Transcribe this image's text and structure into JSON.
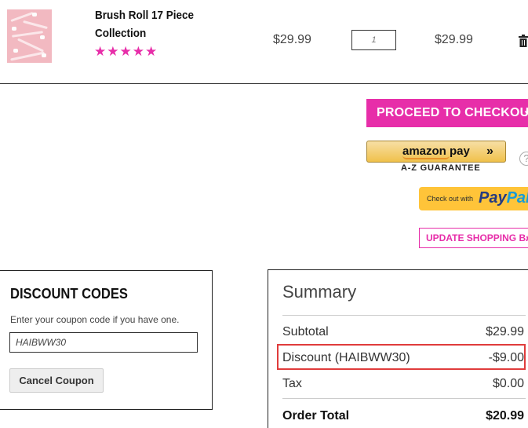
{
  "product": {
    "name": "Brush Roll 17 Piece Collection",
    "rating_stars": "★★★★★",
    "rating_value": 5,
    "price": "$29.99",
    "quantity": "1",
    "line_total": "$29.99"
  },
  "actions": {
    "checkout_label": "PROCEED TO CHECKOUT",
    "checkout_chevron": "›",
    "amazon_label": "amazon pay",
    "amazon_arrows": "»",
    "amazon_guarantee": "A-Z GUARANTEE",
    "help_mark": "?",
    "paypal_small": "Check out with",
    "paypal_logo_a": "Pay",
    "paypal_logo_b": "Pal",
    "update_label": "UPDATE SHOPPING BAG",
    "update_chevron": "›"
  },
  "discount": {
    "title": "DISCOUNT CODES",
    "help_text": "Enter your coupon code if you have one.",
    "code_value": "HAIBWW30",
    "cancel_label": "Cancel Coupon"
  },
  "summary": {
    "title": "Summary",
    "rows": [
      {
        "label": "Subtotal",
        "value": "$29.99"
      },
      {
        "label": "Discount (HAIBWW30)",
        "value": "-$9.00"
      },
      {
        "label": "Tax",
        "value": "$0.00"
      }
    ],
    "order_total_label": "Order Total",
    "order_total_value": "$20.99"
  },
  "colors": {
    "brand_pink": "#e72ea9",
    "highlight_red": "#e03c3c",
    "amazon_gold": "#f0c14b",
    "paypal_yellow": "#ffc439"
  },
  "icons": {
    "trash": "trash-icon",
    "checkout_chevron": "chevron-right-icon",
    "help": "help-icon"
  }
}
